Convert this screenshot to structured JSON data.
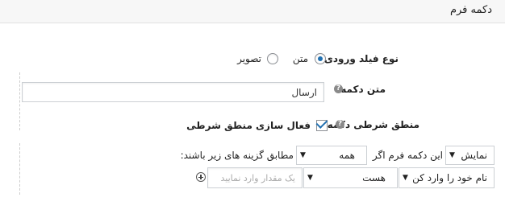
{
  "header": {
    "title": "دکمه فرم"
  },
  "input_type": {
    "label": "نوع فیلد ورودی",
    "options": [
      {
        "label": "متن",
        "selected": true
      },
      {
        "label": "تصویر",
        "selected": false
      }
    ]
  },
  "button_text": {
    "label": "متن دکمه",
    "help": "?",
    "value": "ارسال"
  },
  "conditional_logic": {
    "label": "منطق شرطی دکمه",
    "help": "?",
    "checkbox_label": "فعال سازی منطق شرطی",
    "checked": true,
    "action_select": "نمایش",
    "text_if": "این دکمه فرم اگر",
    "match_select": "همه",
    "text_match": "مطابق گزینه های زیر باشند:",
    "rule": {
      "field_select": "نام خود را وارد کن",
      "operator_select": "هست",
      "value_placeholder": "یک مقدار وارد نمایید"
    }
  },
  "accent_color": "#2271b1"
}
